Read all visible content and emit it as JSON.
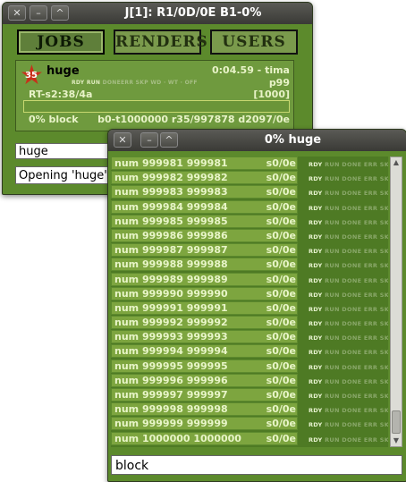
{
  "window1": {
    "title": "J[1]: R1/0D/0E B1-0%",
    "tabs": [
      "JOBS",
      "RENDERS",
      "USERS"
    ],
    "job": {
      "name": "huge",
      "badge": "35",
      "time": "0:04.59 - tima",
      "states": [
        "RDY",
        "RUN",
        "DONE",
        "ERR",
        "SKP",
        "WD",
        "WT",
        "OFF"
      ],
      "priority": "p99",
      "rt": "RT-s2:38/4a",
      "count": "[1000]",
      "progress": 0.0,
      "status": "0% block",
      "frames": "b0-t1000000 r35/997878 d2097/0e"
    },
    "input_value": "huge",
    "status_text": "Opening 'huge' ..."
  },
  "window2": {
    "title": "0% huge",
    "rows": [
      {
        "name": "num 999981 999981",
        "frames": "s0/0e"
      },
      {
        "name": "num 999982 999982",
        "frames": "s0/0e"
      },
      {
        "name": "num 999983 999983",
        "frames": "s0/0e"
      },
      {
        "name": "num 999984 999984",
        "frames": "s0/0e"
      },
      {
        "name": "num 999985 999985",
        "frames": "s0/0e"
      },
      {
        "name": "num 999986 999986",
        "frames": "s0/0e"
      },
      {
        "name": "num 999987 999987",
        "frames": "s0/0e"
      },
      {
        "name": "num 999988 999988",
        "frames": "s0/0e"
      },
      {
        "name": "num 999989 999989",
        "frames": "s0/0e"
      },
      {
        "name": "num 999990 999990",
        "frames": "s0/0e"
      },
      {
        "name": "num 999991 999991",
        "frames": "s0/0e"
      },
      {
        "name": "num 999992 999992",
        "frames": "s0/0e"
      },
      {
        "name": "num 999993 999993",
        "frames": "s0/0e"
      },
      {
        "name": "num 999994 999994",
        "frames": "s0/0e"
      },
      {
        "name": "num 999995 999995",
        "frames": "s0/0e"
      },
      {
        "name": "num 999996 999996",
        "frames": "s0/0e"
      },
      {
        "name": "num 999997 999997",
        "frames": "s0/0e"
      },
      {
        "name": "num 999998 999998",
        "frames": "s0/0e"
      },
      {
        "name": "num 999999 999999",
        "frames": "s0/0e"
      },
      {
        "name": "num 1000000 1000000",
        "frames": "s0/0e"
      }
    ],
    "row_states": {
      "rdy": "RDY",
      "rest": "RUN DONE ERR SKP"
    },
    "input_value": "block"
  },
  "colors": {
    "panel_green": "#5c8a2c",
    "cell_green": "#7da53f",
    "badge_red": "#c8301a",
    "title_bar": "#3a3a36"
  },
  "icons": {
    "close": "close-icon",
    "minimize": "minimize-icon",
    "maximize": "maximize-icon",
    "star": "star-icon"
  }
}
